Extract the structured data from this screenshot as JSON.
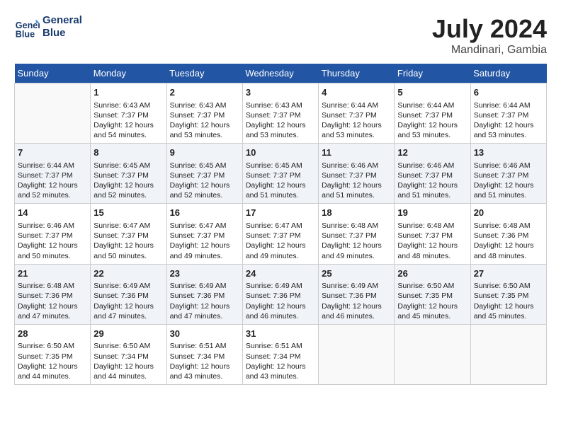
{
  "header": {
    "logo_line1": "General",
    "logo_line2": "Blue",
    "month": "July 2024",
    "location": "Mandinari, Gambia"
  },
  "weekdays": [
    "Sunday",
    "Monday",
    "Tuesday",
    "Wednesday",
    "Thursday",
    "Friday",
    "Saturday"
  ],
  "weeks": [
    [
      {
        "day": "",
        "empty": true
      },
      {
        "day": "1",
        "sunrise": "6:43 AM",
        "sunset": "7:37 PM",
        "daylight": "12 hours and 54 minutes."
      },
      {
        "day": "2",
        "sunrise": "6:43 AM",
        "sunset": "7:37 PM",
        "daylight": "12 hours and 53 minutes."
      },
      {
        "day": "3",
        "sunrise": "6:43 AM",
        "sunset": "7:37 PM",
        "daylight": "12 hours and 53 minutes."
      },
      {
        "day": "4",
        "sunrise": "6:44 AM",
        "sunset": "7:37 PM",
        "daylight": "12 hours and 53 minutes."
      },
      {
        "day": "5",
        "sunrise": "6:44 AM",
        "sunset": "7:37 PM",
        "daylight": "12 hours and 53 minutes."
      },
      {
        "day": "6",
        "sunrise": "6:44 AM",
        "sunset": "7:37 PM",
        "daylight": "12 hours and 53 minutes."
      }
    ],
    [
      {
        "day": "7",
        "sunrise": "6:44 AM",
        "sunset": "7:37 PM",
        "daylight": "12 hours and 52 minutes."
      },
      {
        "day": "8",
        "sunrise": "6:45 AM",
        "sunset": "7:37 PM",
        "daylight": "12 hours and 52 minutes."
      },
      {
        "day": "9",
        "sunrise": "6:45 AM",
        "sunset": "7:37 PM",
        "daylight": "12 hours and 52 minutes."
      },
      {
        "day": "10",
        "sunrise": "6:45 AM",
        "sunset": "7:37 PM",
        "daylight": "12 hours and 51 minutes."
      },
      {
        "day": "11",
        "sunrise": "6:46 AM",
        "sunset": "7:37 PM",
        "daylight": "12 hours and 51 minutes."
      },
      {
        "day": "12",
        "sunrise": "6:46 AM",
        "sunset": "7:37 PM",
        "daylight": "12 hours and 51 minutes."
      },
      {
        "day": "13",
        "sunrise": "6:46 AM",
        "sunset": "7:37 PM",
        "daylight": "12 hours and 51 minutes."
      }
    ],
    [
      {
        "day": "14",
        "sunrise": "6:46 AM",
        "sunset": "7:37 PM",
        "daylight": "12 hours and 50 minutes."
      },
      {
        "day": "15",
        "sunrise": "6:47 AM",
        "sunset": "7:37 PM",
        "daylight": "12 hours and 50 minutes."
      },
      {
        "day": "16",
        "sunrise": "6:47 AM",
        "sunset": "7:37 PM",
        "daylight": "12 hours and 49 minutes."
      },
      {
        "day": "17",
        "sunrise": "6:47 AM",
        "sunset": "7:37 PM",
        "daylight": "12 hours and 49 minutes."
      },
      {
        "day": "18",
        "sunrise": "6:48 AM",
        "sunset": "7:37 PM",
        "daylight": "12 hours and 49 minutes."
      },
      {
        "day": "19",
        "sunrise": "6:48 AM",
        "sunset": "7:37 PM",
        "daylight": "12 hours and 48 minutes."
      },
      {
        "day": "20",
        "sunrise": "6:48 AM",
        "sunset": "7:36 PM",
        "daylight": "12 hours and 48 minutes."
      }
    ],
    [
      {
        "day": "21",
        "sunrise": "6:48 AM",
        "sunset": "7:36 PM",
        "daylight": "12 hours and 47 minutes."
      },
      {
        "day": "22",
        "sunrise": "6:49 AM",
        "sunset": "7:36 PM",
        "daylight": "12 hours and 47 minutes."
      },
      {
        "day": "23",
        "sunrise": "6:49 AM",
        "sunset": "7:36 PM",
        "daylight": "12 hours and 47 minutes."
      },
      {
        "day": "24",
        "sunrise": "6:49 AM",
        "sunset": "7:36 PM",
        "daylight": "12 hours and 46 minutes."
      },
      {
        "day": "25",
        "sunrise": "6:49 AM",
        "sunset": "7:36 PM",
        "daylight": "12 hours and 46 minutes."
      },
      {
        "day": "26",
        "sunrise": "6:50 AM",
        "sunset": "7:35 PM",
        "daylight": "12 hours and 45 minutes."
      },
      {
        "day": "27",
        "sunrise": "6:50 AM",
        "sunset": "7:35 PM",
        "daylight": "12 hours and 45 minutes."
      }
    ],
    [
      {
        "day": "28",
        "sunrise": "6:50 AM",
        "sunset": "7:35 PM",
        "daylight": "12 hours and 44 minutes."
      },
      {
        "day": "29",
        "sunrise": "6:50 AM",
        "sunset": "7:34 PM",
        "daylight": "12 hours and 44 minutes."
      },
      {
        "day": "30",
        "sunrise": "6:51 AM",
        "sunset": "7:34 PM",
        "daylight": "12 hours and 43 minutes."
      },
      {
        "day": "31",
        "sunrise": "6:51 AM",
        "sunset": "7:34 PM",
        "daylight": "12 hours and 43 minutes."
      },
      {
        "day": "",
        "empty": true
      },
      {
        "day": "",
        "empty": true
      },
      {
        "day": "",
        "empty": true
      }
    ]
  ]
}
